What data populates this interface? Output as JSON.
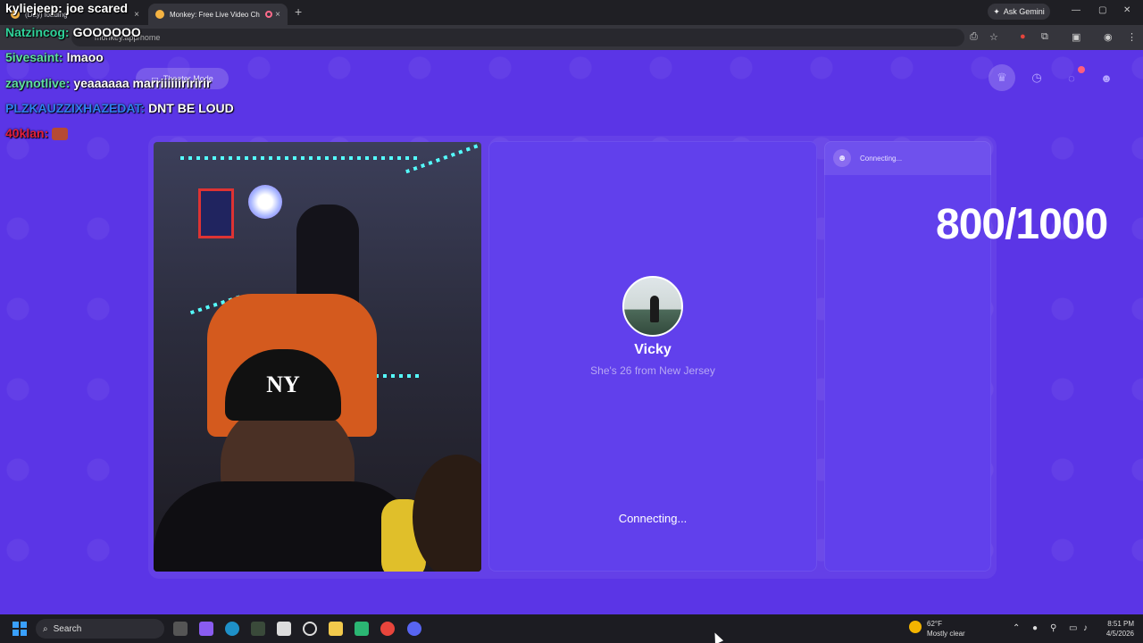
{
  "browser": {
    "tabs": [
      {
        "label": "(Day) loading"
      },
      {
        "label": "Monkey: Free Live Video Ch"
      }
    ],
    "new_tab": "+",
    "ask_gemini": "Ask Gemini",
    "url": "monkey.app/home"
  },
  "page": {
    "theater_mode": "Theater Mode",
    "remote_user": {
      "name": "Vicky",
      "subtitle": "She's 26 from New Jersey"
    },
    "connecting_main": "Connecting...",
    "chat_panel": {
      "status": "Connecting..."
    },
    "nav_icons": [
      "crown-icon",
      "clock-icon",
      "chat-icon",
      "monkey-icon"
    ],
    "notification_count": "1"
  },
  "overlay": {
    "counter": "800/1000",
    "chat": [
      {
        "user": "kyliejeep:",
        "message": "joe scared",
        "color": "#ffffff"
      },
      {
        "user": "Natzincog:",
        "message": "GOOOOOO",
        "color": "#2fd39a"
      },
      {
        "user": "5ivesaint:",
        "message": "lmaoo",
        "color": "#5ee0a0"
      },
      {
        "user": "zaynotlive:",
        "message": "yeaaaaaa marriiiiiiriririr",
        "color": "#5ee0a0"
      },
      {
        "user": "PLZKAUZZIXHAZEDAT:",
        "message": "DNT BE LOUD",
        "color": "#2f7ef0"
      },
      {
        "user": "40klan:",
        "message": "",
        "color": "#e0203a"
      }
    ]
  },
  "taskbar": {
    "search": "Search",
    "weather_temp": "62°F",
    "weather_desc": "Mostly clear",
    "time": "8:51 PM",
    "date": "4/5/2026"
  }
}
